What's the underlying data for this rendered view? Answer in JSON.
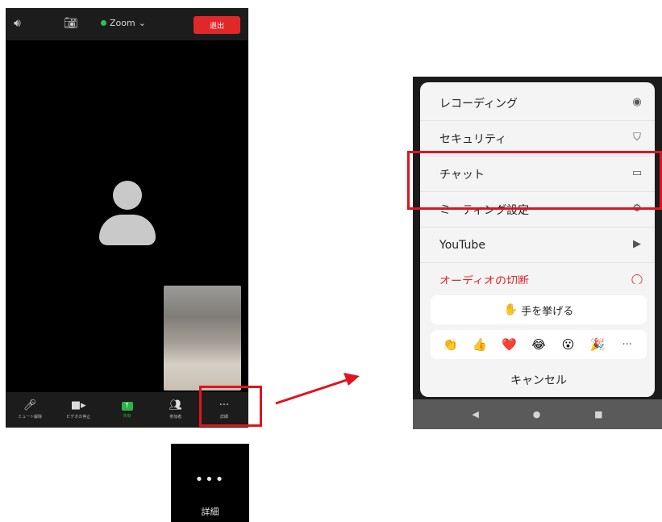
{
  "left_phone": {
    "topbar": {
      "speaker_icon": "speaker-icon",
      "camera_flip_icon": "camera-flip-icon",
      "meeting_title": "Zoom",
      "leave_label": "退出"
    },
    "bottombar": {
      "items": [
        {
          "label": "ミュート解除",
          "icon": "mic-icon"
        },
        {
          "label": "ビデオの停止",
          "icon": "video-icon"
        },
        {
          "label": "共有",
          "icon": "share-icon"
        },
        {
          "label": "参加者",
          "icon": "participants-icon"
        },
        {
          "label": "詳細",
          "icon": "more-icon"
        }
      ]
    }
  },
  "zoomed_more": {
    "dots": "•••",
    "label": "詳細"
  },
  "menu": {
    "items": [
      {
        "label": "レコーディング",
        "icon": "record-icon"
      },
      {
        "label": "セキュリティ",
        "icon": "shield-icon"
      },
      {
        "label": "チャット",
        "icon": "chat-icon"
      },
      {
        "label": "ミーティング設定",
        "icon": "settings-icon"
      },
      {
        "label": "YouTube",
        "icon": "youtube-icon"
      },
      {
        "label": "オーディオの切断",
        "icon": "disconnect-icon"
      }
    ],
    "raise_hand_label": "手を挙げる",
    "reactions": [
      "👏",
      "👍",
      "❤️",
      "😂",
      "😮",
      "🎉",
      "···"
    ],
    "cancel_label": "キャンセル"
  },
  "colors": {
    "leave": "#e02828",
    "highlight": "#e0141e",
    "share": "#2bb34a"
  }
}
